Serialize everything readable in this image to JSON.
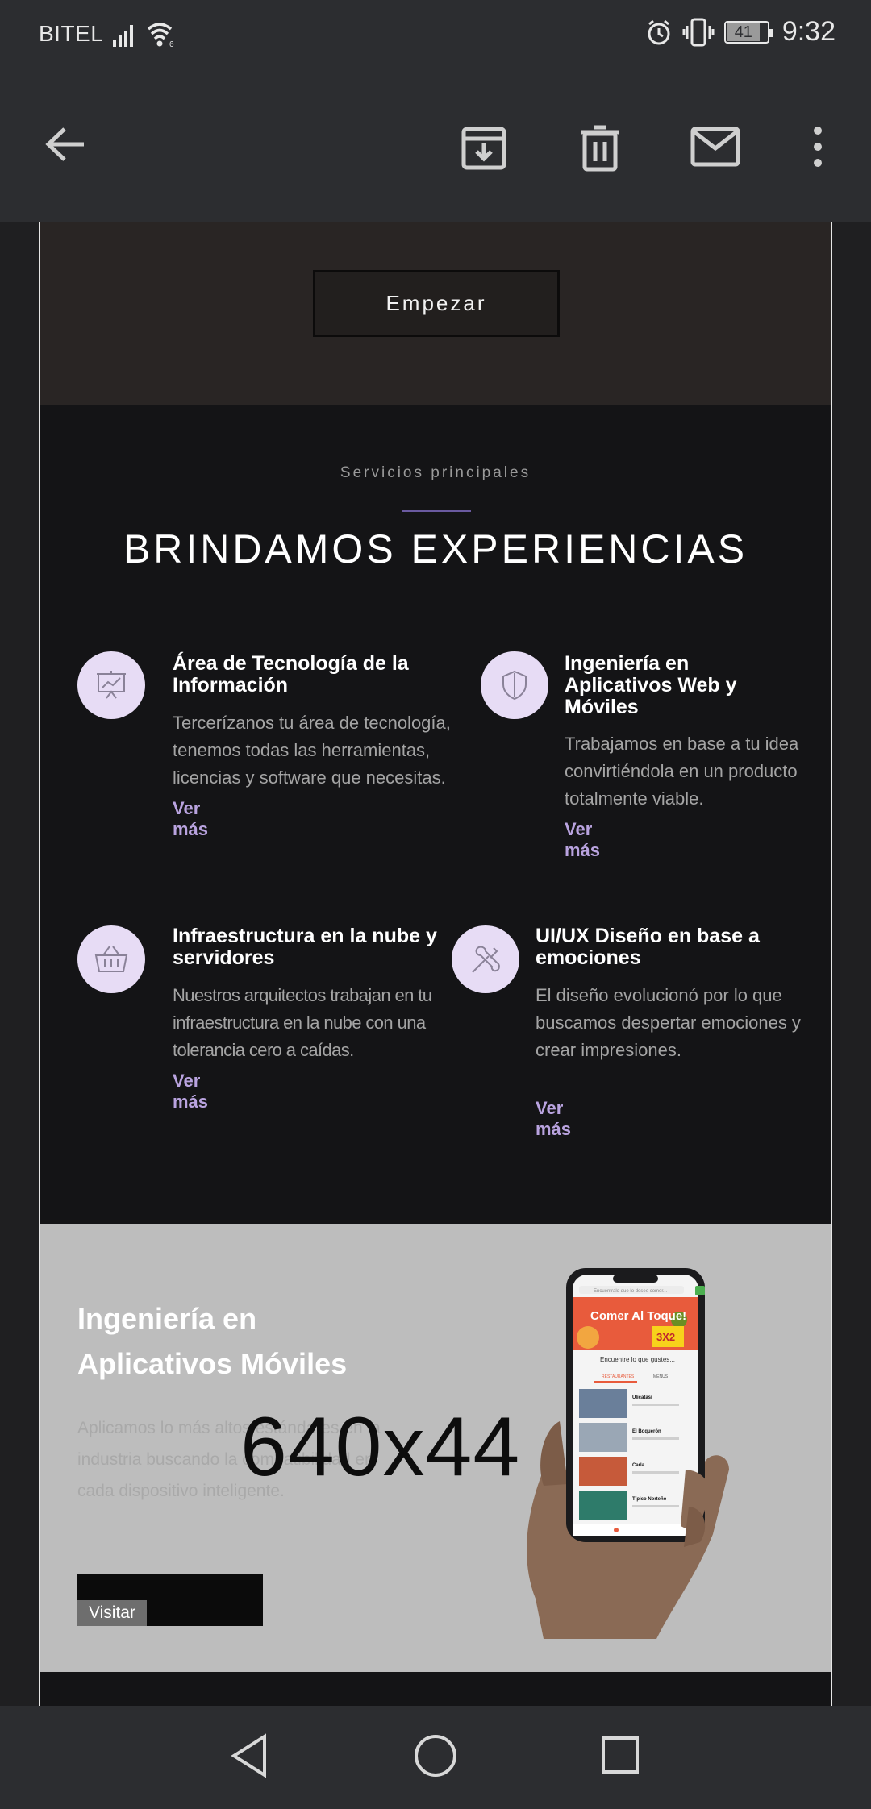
{
  "status_bar": {
    "carrier": "BITEL",
    "battery": "41",
    "time": "9:32"
  },
  "app_bar": {
    "back": "arrow-left-icon",
    "actions": [
      "archive-icon",
      "trash-icon",
      "mail-icon",
      "more-vert-icon"
    ]
  },
  "hero": {
    "start_label": "Empezar"
  },
  "services": {
    "eyebrow": "Servicios principales",
    "headline": "BRINDAMOS EXPERIENCIAS",
    "items": [
      {
        "title": "Área de Tecnología de la Información",
        "desc": "Tercerízanos tu área de tecnología, tenemos todas las herramientas, licencias y software que necesitas.",
        "link": "Ver más",
        "icon": "presentation-chart-icon"
      },
      {
        "title": "Ingeniería en Aplicativos Web y Móviles",
        "desc": "Trabajamos en base a tu idea convirtiéndola en un producto totalmente viable.",
        "link": "Ver más",
        "icon": "shield-icon"
      },
      {
        "title": "Infraestructura en la nube y servidores",
        "desc": "Nuestros arquitectos trabajan en tu infraestructura en la nube con una tolerancia cero a caídas.",
        "link": "Ver más",
        "icon": "basket-icon"
      },
      {
        "title": "UI/UX Diseño en base a emociones",
        "desc": "El diseño evolucionó por lo que buscamos despertar emociones y crear impresiones.",
        "link": "Ver más",
        "icon": "tools-icon"
      }
    ]
  },
  "promo": {
    "title_line1": "Ingeniería en",
    "title_line2": "Aplicativos Móviles",
    "desc": "Aplicamos lo más altos estándares en la industria buscando la compatibilidad en cada dispositivo inteligente.",
    "placeholder": "640x44",
    "visit_label": "Visitar",
    "phone_screen": {
      "search_placeholder": "Encuéntralo que lo desee comer...",
      "banner": "Comer Al Toque!",
      "promo_badge": "3X2",
      "subtitle": "Encuentre lo que gustes...",
      "tabs": [
        "RESTAURANTES",
        "MENUS"
      ],
      "restaurants": [
        "Ulicatasi",
        "El Boquerón",
        "Carla",
        "Típico Norteño"
      ]
    }
  },
  "nav_bar": {
    "buttons": [
      "back-triangle-icon",
      "home-circle-icon",
      "recents-square-icon"
    ]
  },
  "colors": {
    "accent": "#b9a3df",
    "icon_bg": "#e7dcf5",
    "services_bg": "#141416",
    "promo_bg": "#bdbdbd"
  }
}
